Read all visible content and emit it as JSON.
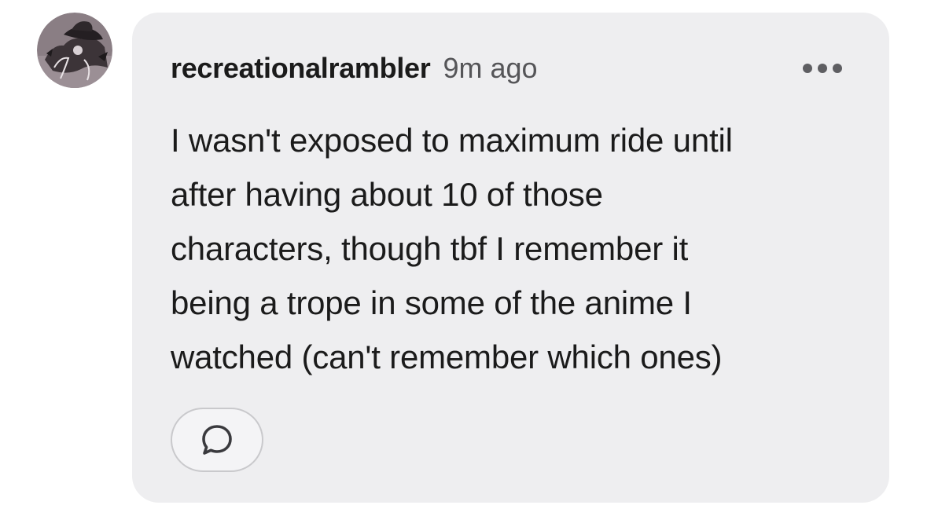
{
  "comment": {
    "username": "recreationalrambler",
    "timestamp": "9m ago",
    "body_lines": [
      "I wasn't exposed to maximum ride until",
      "after having about 10 of those",
      "characters, though tbf I remember it",
      "being a trope in some of the anime I",
      "watched (can't remember which ones)"
    ],
    "avatar_icon": "avatar-image",
    "more_icon": "ellipsis-icon",
    "reply_icon": "speech-bubble-icon"
  },
  "colors": {
    "card_background": "#eeeef0",
    "text_primary": "#1b1b1b",
    "text_secondary": "#555558",
    "button_border": "#c9c9cc"
  }
}
